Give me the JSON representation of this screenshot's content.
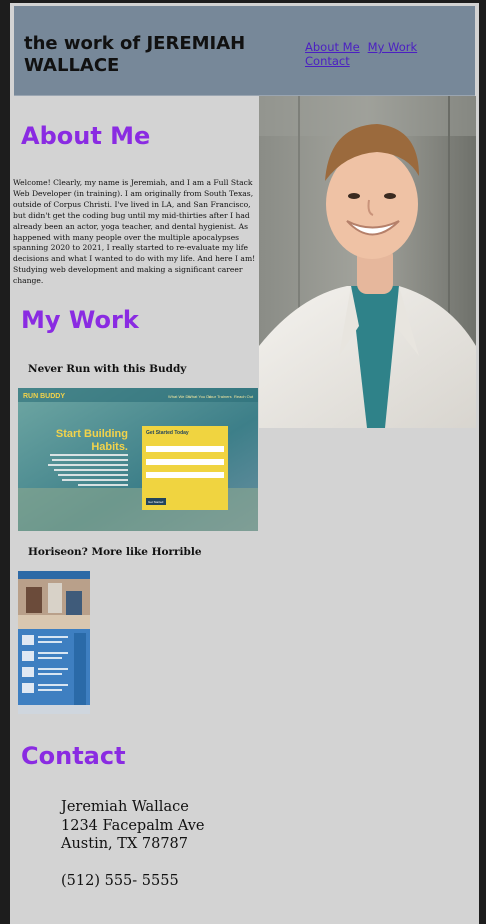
{
  "header": {
    "site_title": "the work of JEREMIAH WALLACE",
    "nav": [
      {
        "label": "About Me"
      },
      {
        "label": "My Work"
      },
      {
        "label": "Contact"
      }
    ]
  },
  "about": {
    "heading": "About Me",
    "text": "Welcome! Clearly, my name is Jeremiah, and I am a Full Stack Web Developer (in training). I am originally from South Texas, outside of Corpus Christi. I've lived in LA, and San Francisco, but didn't get the coding bug until my mid-thirties after I had already been an actor, yoga teacher, and dental hygienist. As happened with many people over the multiple apocalypses spanning 2020 to 2021, I really started to re-evaluate my life decisions and what I wanted to do with my life. And here I am! Studying web development and making a significant career change."
  },
  "work": {
    "heading": "My Work",
    "projects": [
      {
        "title": "Never Run with this Buddy",
        "screenshot": {
          "brand": "RUN BUDDY",
          "nav": [
            "What We Do",
            "What You Do",
            "Your Trainers",
            "Reach Out"
          ],
          "hero_line1": "Start Building",
          "hero_line2": "Habits.",
          "form_title": "Get Started Today",
          "form_button": "Get Started"
        }
      },
      {
        "title": "Horiseon? More like Horrible"
      }
    ]
  },
  "contact": {
    "heading": "Contact",
    "name": "Jeremiah Wallace",
    "street": "1234 Facepalm Ave",
    "city": "Austin, TX 78787",
    "phone": "(512) 555- 5555"
  }
}
